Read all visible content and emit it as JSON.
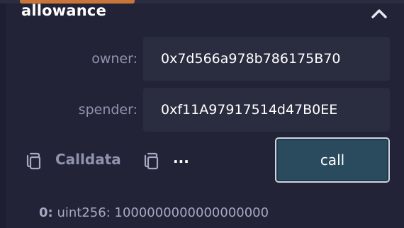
{
  "function": {
    "name": "allowance"
  },
  "inputs": [
    {
      "label": "owner:",
      "value": "0x7d566a978b786175B70"
    },
    {
      "label": "spender:",
      "value": "0xf11A97917514d47B0EE"
    }
  ],
  "actions": {
    "calldata_label": "Calldata",
    "more_label": "...",
    "call_label": "call"
  },
  "result": {
    "index": "0:",
    "text": "uint256: 1000000000000000000"
  },
  "icons": {
    "collapse": "chevron-up-icon",
    "copy_calldata": "copy-icon",
    "copy_more": "copy-icon"
  },
  "colors": {
    "background": "#222336",
    "input_background": "#2a2c3f",
    "accent": "#c97539",
    "call_button": "#2a4a5e",
    "label": "#8f93ad"
  }
}
